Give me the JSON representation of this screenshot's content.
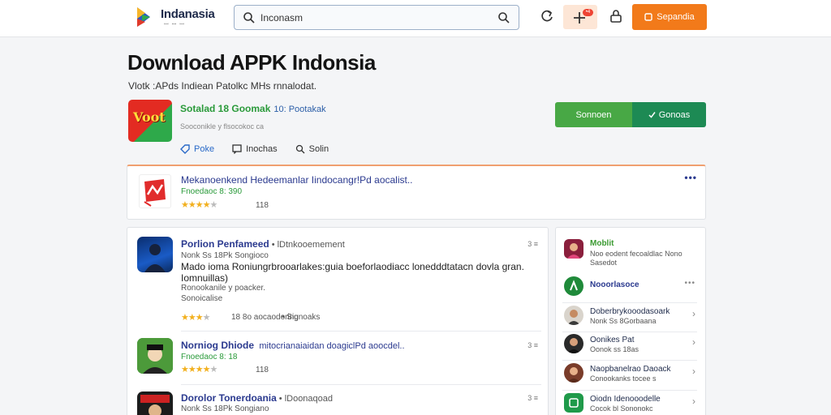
{
  "header": {
    "brand": "Indanasia",
    "brand_sub": "ꟷ ꟷ ꟷ",
    "search_value": "Inconasm",
    "notif_count": "•4",
    "cta_label": "Sepandia",
    "colors": {
      "accent": "#f27a1a",
      "search_border": "#9cb0c9"
    }
  },
  "page": {
    "title": "Download APPK Indonsia",
    "subtitle": "Vlotk :APds Indiean Patolkc MHs rnnalodat."
  },
  "app": {
    "icon_text": "Voot",
    "name": "Sotalad 18 Goomak",
    "meta": "10: Pootakak",
    "line": "Sooconikle y flsocokoc ca",
    "actions": [
      {
        "label": "Poke",
        "icon": "tag-icon"
      },
      {
        "label": "Inochas",
        "icon": "comment-icon"
      },
      {
        "label": "Solin",
        "icon": "search-icon"
      }
    ],
    "download_left": "Sonnoen",
    "download_right": "Gonoas",
    "colors": {
      "green": "#48a845",
      "dark_green": "#1d8a54"
    }
  },
  "featured": {
    "title": "Mekanoenkend Hedeemanlar Iindocangr!Pd aocalist..",
    "version": "Fnoedaoc 8: 390",
    "rating": 4,
    "count": "118",
    "more": "•••"
  },
  "list": [
    {
      "name": "Porlion Penfameed",
      "sub": "• lDtnkooemement",
      "line1": "Nonk Ss 18Pk Songioco",
      "desc": "Mado ioma Roniungrbrooarlakes:guia boeforlaodiacc lonedddtatacn dovla gran. Iomnuillas)",
      "line2": "Ronookanile y poacker.",
      "line3": "Sonoicalise",
      "rating": 4,
      "meta": "18 8o aocaodoring",
      "meta2": "• Signoaks",
      "dots": "3 ≡"
    },
    {
      "name": "Norniog Dhiode",
      "sub": "mitocrianaiaidan doagiclPd aoocdel..",
      "line1": "Fnoedaoc 8: 18",
      "rating": 4,
      "count": "118",
      "dots": "3 ≡"
    },
    {
      "name": "Dorolor Tonerdoania",
      "sub": "• lDoonaqoad",
      "line1": "Nonk Ss 18Pk Songiano",
      "dots": "3 ≡"
    }
  ],
  "side": [
    {
      "name": "Moblit",
      "line": "Noo eodent fecoaldlac Nono Sasedot",
      "name_color": "#3a9a30"
    },
    {
      "name": "Nooorlasoce",
      "line": "",
      "dots": "•••"
    },
    {
      "name": "Doberbrykooodasoark",
      "line": "Nonk Ss 8Gorbaana"
    },
    {
      "name": "Oonikes Pat",
      "line": "Oonok ss 18as"
    },
    {
      "name": "Naopbanelrao Daoack",
      "line": "Conookanks tocee s"
    },
    {
      "name": "Oiodn Idenooodelle",
      "line": "Cocok bl Sononokc"
    }
  ]
}
